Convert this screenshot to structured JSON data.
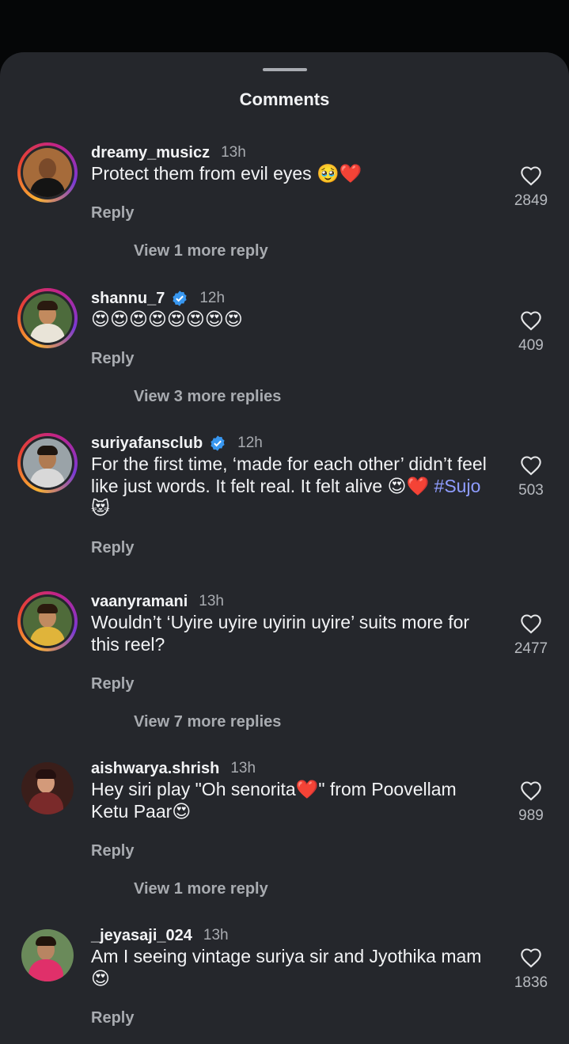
{
  "sheet": {
    "title": "Comments"
  },
  "reply_label": "Reply",
  "comments": [
    {
      "username": "dreamy_musicz",
      "time": "13h",
      "verified": false,
      "text": "Protect them from evil eyes 🥹❤️",
      "likes": "2849",
      "view_replies": "View 1 more reply"
    },
    {
      "username": "shannu_7",
      "time": "12h",
      "verified": true,
      "text": "😍😍😍😍😍😍😍😍",
      "likes": "409",
      "view_replies": "View 3 more replies"
    },
    {
      "username": "suriyafansclub",
      "time": "12h",
      "verified": true,
      "text": "For the first time, ‘made for each other’ didn’t feel like just words. It felt real. It felt alive 😍❤️ ",
      "hashtag": "#Sujo",
      "text_end": " 😻",
      "likes": "503"
    },
    {
      "username": "vaanyramani",
      "time": "13h",
      "verified": false,
      "text": "Wouldn’t ‘Uyire uyire uyirin uyire’ suits more for this reel?",
      "likes": "2477",
      "view_replies": "View 7 more replies"
    },
    {
      "username": "aishwarya.shrish",
      "time": "13h",
      "verified": false,
      "text": "Hey siri play \"Oh senorita❤️\" from Poovellam Ketu Paar😍",
      "likes": "989",
      "view_replies": "View 1 more reply"
    },
    {
      "username": "_jeyasaji_024",
      "time": "13h",
      "verified": false,
      "text": "Am I seeing vintage suriya sir and Jyothika mam😍",
      "likes": "1836"
    }
  ],
  "colors": {
    "background": "#050607",
    "sheet": "#25272c",
    "text": "#f2f3f5",
    "muted": "#a8abb0",
    "verified": "#3897f0",
    "hashtag": "#8f9dff"
  },
  "icons": {
    "like": "heart-outline-icon",
    "verified": "verified-badge-icon"
  }
}
